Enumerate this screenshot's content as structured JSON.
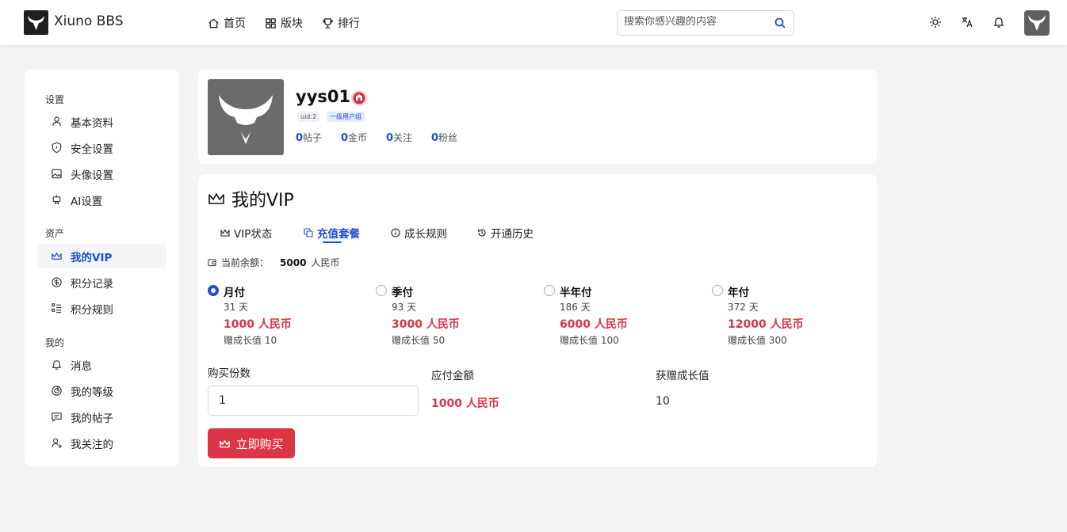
{
  "header": {
    "brand": "Xiuno BBS",
    "nav": [
      {
        "label": "首页",
        "icon": "home-icon"
      },
      {
        "label": "版块",
        "icon": "grid-icon"
      },
      {
        "label": "排行",
        "icon": "trophy-icon"
      }
    ],
    "search_placeholder": "搜索你感兴趣的内容"
  },
  "sidebar": {
    "sections": [
      {
        "title": "设置",
        "items": [
          {
            "label": "基本资料",
            "icon": "user-icon"
          },
          {
            "label": "安全设置",
            "icon": "shield-icon"
          },
          {
            "label": "头像设置",
            "icon": "image-icon"
          },
          {
            "label": "AI设置",
            "icon": "robot-icon"
          }
        ]
      },
      {
        "title": "资产",
        "items": [
          {
            "label": "我的VIP",
            "icon": "crown-icon",
            "active": true
          },
          {
            "label": "积分记录",
            "icon": "coin-icon"
          },
          {
            "label": "积分规则",
            "icon": "list-icon"
          }
        ]
      },
      {
        "title": "我的",
        "items": [
          {
            "label": "消息",
            "icon": "bell-icon"
          },
          {
            "label": "我的等级",
            "icon": "level-icon"
          },
          {
            "label": "我的帖子",
            "icon": "message-icon"
          },
          {
            "label": "我关注的",
            "icon": "user-plus-icon"
          }
        ]
      }
    ]
  },
  "profile": {
    "username": "yys01",
    "uid_tag": "uid:2",
    "group_tag": "一级用户组",
    "stats": [
      {
        "value": "0",
        "label": "帖子"
      },
      {
        "value": "0",
        "label": "金币"
      },
      {
        "value": "0",
        "label": "关注"
      },
      {
        "value": "0",
        "label": "粉丝"
      }
    ]
  },
  "vip": {
    "title": "我的VIP",
    "tabs": [
      {
        "label": "VIP状态",
        "icon": "crown-icon"
      },
      {
        "label": "充值套餐",
        "icon": "copy-icon",
        "active": true
      },
      {
        "label": "成长规则",
        "icon": "info-icon"
      },
      {
        "label": "开通历史",
        "icon": "history-icon"
      }
    ],
    "balance_label": "当前余额：",
    "balance_value": "5000",
    "balance_unit": "人民币",
    "plans": [
      {
        "name": "月付",
        "days": "31 天",
        "price": "1000 人民币",
        "bonus": "赠成长值 10",
        "selected": true
      },
      {
        "name": "季付",
        "days": "93 天",
        "price": "3000 人民币",
        "bonus": "赠成长值 50",
        "selected": false
      },
      {
        "name": "半年付",
        "days": "186 天",
        "price": "6000 人民币",
        "bonus": "赠成长值 100",
        "selected": false
      },
      {
        "name": "年付",
        "days": "372 天",
        "price": "12000 人民币",
        "bonus": "赠成长值 300",
        "selected": false
      }
    ],
    "qty_label": "购买份数",
    "qty_value": "1",
    "pay_label": "应付金额",
    "pay_value": "1000 人民币",
    "growth_label": "获赠成长值",
    "growth_value": "10",
    "buy_label": "立即购买"
  },
  "colors": {
    "accent": "#1f4fd1",
    "danger": "#dc3545"
  }
}
